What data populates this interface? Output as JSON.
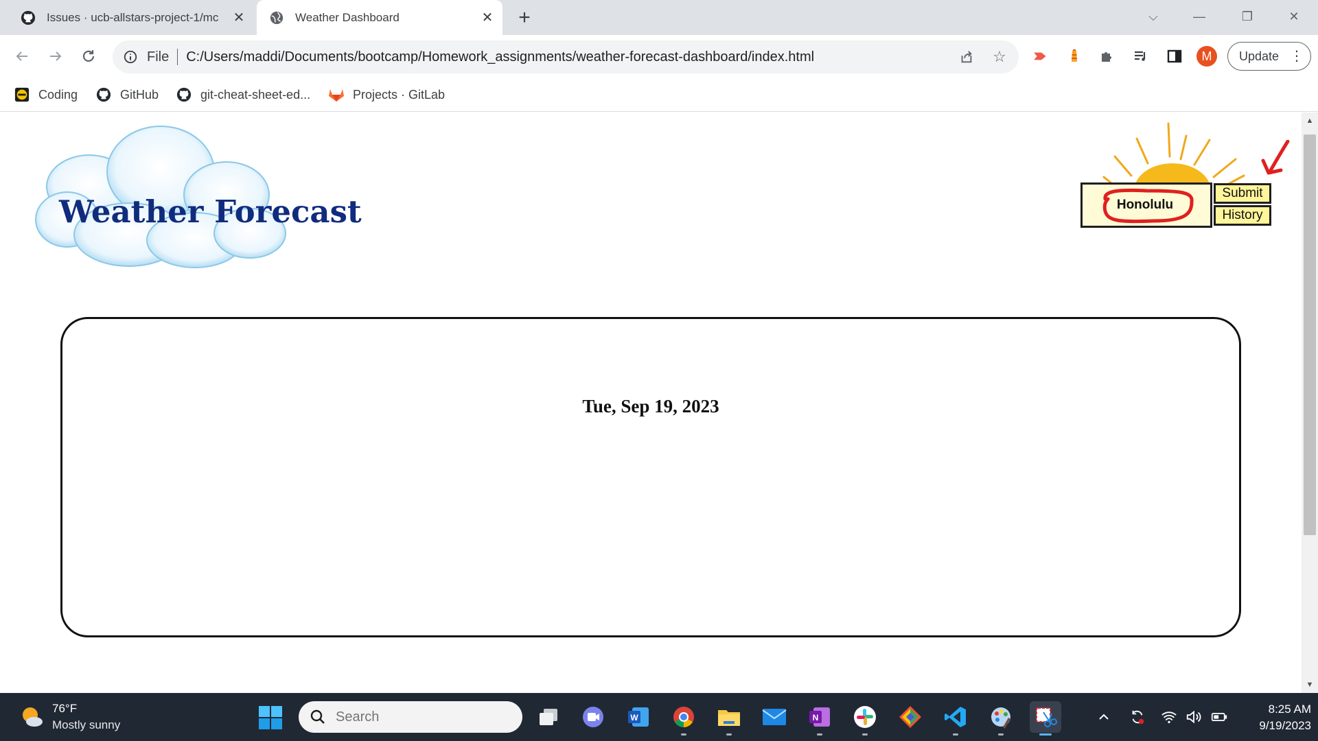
{
  "browser": {
    "tabs": [
      {
        "title": "Issues · ucb-allstars-project-1/mc",
        "active": false
      },
      {
        "title": "Weather Dashboard",
        "active": true
      }
    ],
    "address": {
      "scheme_label": "File",
      "url": "C:/Users/maddi/Documents/bootcamp/Homework_assignments/weather-forecast-dashboard/index.html"
    },
    "profile_initial": "M",
    "update_label": "Update",
    "bookmarks": [
      {
        "label": "Coding",
        "icon": "coding-folder-icon"
      },
      {
        "label": "GitHub",
        "icon": "github-icon"
      },
      {
        "label": "git-cheat-sheet-ed...",
        "icon": "github-icon"
      },
      {
        "label": "Projects · GitLab",
        "icon": "gitlab-icon"
      }
    ]
  },
  "page": {
    "logo_title": "Weather Forecast",
    "search": {
      "city_value": "Honolulu"
    },
    "buttons": {
      "submit": "Submit",
      "history": "History"
    },
    "forecast": {
      "date": "Tue, Sep 19, 2023"
    },
    "colors": {
      "title": "#102c7e",
      "input_bg": "#fffbd6",
      "button_bg": "#fff59a",
      "annotation": "#e02020"
    }
  },
  "taskbar": {
    "weather": {
      "temp": "76°F",
      "condition": "Mostly sunny"
    },
    "search_placeholder": "Search",
    "apps": [
      "task-view",
      "teams",
      "word",
      "chrome",
      "file-explorer",
      "mail",
      "onenote",
      "slack",
      "git-kraken",
      "vscode",
      "paint",
      "snipping-tool"
    ],
    "clock": {
      "time": "8:25 AM",
      "date": "9/19/2023"
    }
  }
}
